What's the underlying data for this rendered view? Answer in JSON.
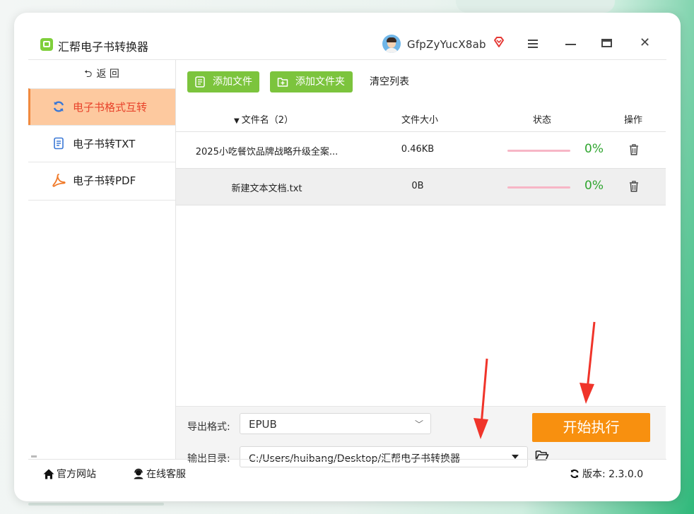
{
  "app": {
    "title": "汇帮电子书转换器"
  },
  "user": {
    "name": "GfpZyYucX8ab"
  },
  "sidebar": {
    "back_label": "返  回",
    "items": [
      {
        "label": "电子书格式互转",
        "icon": "refresh-icon",
        "active": true
      },
      {
        "label": "电子书转TXT",
        "icon": "document-icon",
        "active": false
      },
      {
        "label": "电子书转PDF",
        "icon": "pdf-icon",
        "active": false
      }
    ]
  },
  "toolbar": {
    "add_file": "添加文件",
    "add_folder": "添加文件夹",
    "clear_list": "清空列表"
  },
  "table": {
    "headers": {
      "name": "文件名（2）",
      "size": "文件大小",
      "status": "状态",
      "action": "操作"
    },
    "rows": [
      {
        "name": "2025小吃餐饮品牌战略升级全案...",
        "size": "0.46KB",
        "progress": "0%"
      },
      {
        "name": "新建文本文档.txt",
        "size": "0B",
        "progress": "0%"
      }
    ]
  },
  "export": {
    "format_label": "导出格式:",
    "format_value": "EPUB",
    "dir_label": "输出目录:",
    "dir_value": "C:/Users/huibang/Desktop/汇帮电子书转换器",
    "start_button": "开始执行"
  },
  "footer": {
    "website": "官方网站",
    "service": "在线客服",
    "version": "版本: 2.3.0.0"
  },
  "colors": {
    "accent_green": "#7cc43d",
    "start_orange": "#f8900f",
    "active_item_bg": "#fdc99f",
    "active_item_text": "#e8432b",
    "progress_pct": "#2fa52f",
    "arrow_red": "#f0342a"
  }
}
